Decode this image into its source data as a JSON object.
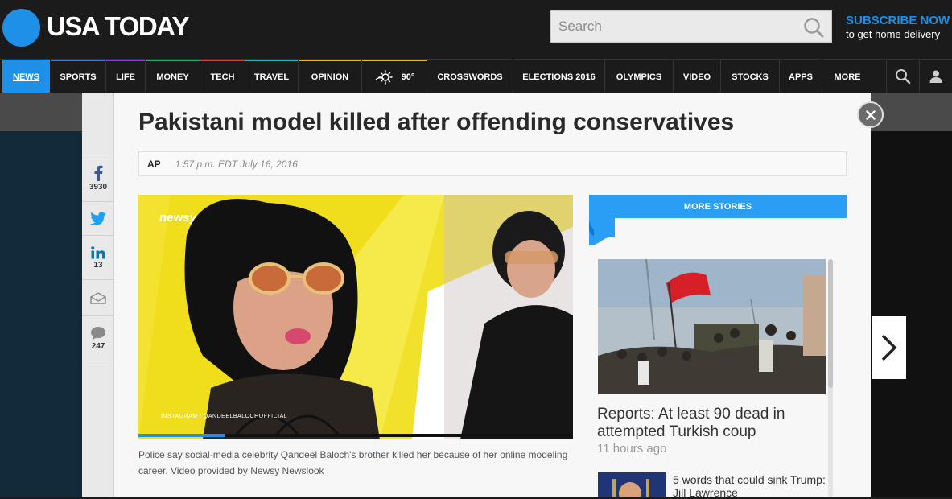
{
  "brand": {
    "name": "USA TODAY"
  },
  "search": {
    "placeholder": "Search"
  },
  "subscribe": {
    "title": "SUBSCRIBE NOW",
    "line": "to get home delivery"
  },
  "nav": {
    "items": [
      "NEWS",
      "SPORTS",
      "LIFE",
      "MONEY",
      "TECH",
      "TRAVEL",
      "OPINION",
      "CROSSWORDS",
      "ELECTIONS 2016",
      "OLYMPICS",
      "VIDEO",
      "STOCKS",
      "APPS",
      "MORE"
    ],
    "weather": "90°"
  },
  "share": {
    "facebook_count": "3930",
    "linkedin_count": "13",
    "comment_count": "247"
  },
  "article": {
    "headline": "Pakistani model killed after offending conservatives",
    "source": "AP",
    "dateline": "1:57 p.m. EDT July 16, 2016",
    "video_watermark": "newsy",
    "video_credit": "INSTAGRAM / QANDEELBALOCHOFFICIAL",
    "video_progress": 0.2,
    "caption": "Police say social-media celebrity Qandeel Baloch's brother killed her because of her online modeling career. Video provided by Newsy Newslook"
  },
  "more_stories": {
    "header": "MORE STORIES",
    "stories": [
      {
        "title": "Reports: At least 90 dead in attempted Turkish coup",
        "time": "11 hours ago"
      },
      {
        "title": "5 words that could sink Trump: Jill Lawrence"
      }
    ]
  },
  "colors": {
    "brand_blue": "#1e90e8",
    "header_bg": "#1b1b1b",
    "panel_bg": "#f7f7f7"
  }
}
